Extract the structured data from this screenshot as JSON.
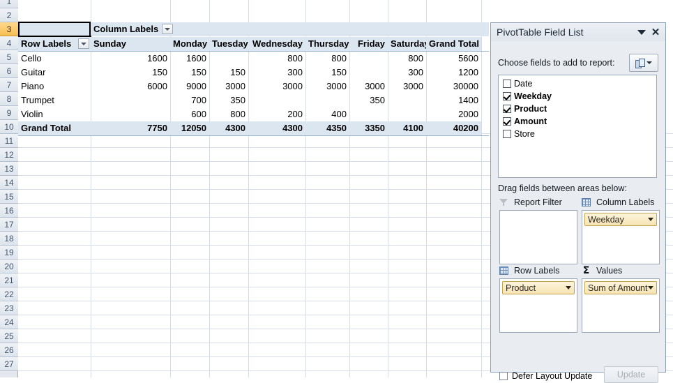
{
  "sheet": {
    "row_headers": [
      "1",
      "2",
      "3",
      "4",
      "5",
      "6",
      "7",
      "8",
      "9",
      "10",
      "11",
      "12",
      "13",
      "14",
      "15",
      "16",
      "17",
      "18",
      "19",
      "20",
      "21",
      "22",
      "23",
      "24",
      "25",
      "26",
      "27"
    ],
    "active_row": "3"
  },
  "pivot": {
    "value_header": "Sum of Amount",
    "column_labels_header": "Column Labels",
    "row_labels_header": "Row Labels",
    "columns": [
      "Sunday",
      "Monday",
      "Tuesday",
      "Wednesday",
      "Thursday",
      "Friday",
      "Saturday",
      "Grand Total"
    ],
    "rows": [
      {
        "label": "Cello",
        "values": [
          "1600",
          "1600",
          "",
          "800",
          "800",
          "",
          "800",
          "5600"
        ]
      },
      {
        "label": "Guitar",
        "values": [
          "150",
          "150",
          "150",
          "300",
          "150",
          "",
          "300",
          "1200"
        ]
      },
      {
        "label": "Piano",
        "values": [
          "6000",
          "9000",
          "3000",
          "3000",
          "3000",
          "3000",
          "3000",
          "30000"
        ]
      },
      {
        "label": "Trumpet",
        "values": [
          "",
          "700",
          "350",
          "",
          "",
          "350",
          "",
          "1400"
        ]
      },
      {
        "label": "Violin",
        "values": [
          "",
          "600",
          "800",
          "200",
          "400",
          "",
          "",
          "2000"
        ]
      }
    ],
    "grand_total": {
      "label": "Grand Total",
      "values": [
        "7750",
        "12050",
        "4300",
        "4300",
        "4350",
        "3350",
        "4100",
        "40200"
      ]
    }
  },
  "panel": {
    "title": "PivotTable Field List",
    "choose_label": "Choose fields to add to report:",
    "fields": [
      {
        "name": "Date",
        "checked": false
      },
      {
        "name": "Weekday",
        "checked": true
      },
      {
        "name": "Product",
        "checked": true
      },
      {
        "name": "Amount",
        "checked": true
      },
      {
        "name": "Store",
        "checked": false
      }
    ],
    "drag_label": "Drag fields between areas below:",
    "areas": {
      "report_filter": {
        "label": "Report Filter",
        "items": []
      },
      "column_labels": {
        "label": "Column Labels",
        "items": [
          "Weekday"
        ]
      },
      "row_labels": {
        "label": "Row Labels",
        "items": [
          "Product"
        ]
      },
      "values": {
        "label": "Values",
        "items": [
          "Sum of Amount"
        ]
      }
    },
    "defer_label": "Defer Layout Update",
    "update_label": "Update"
  },
  "colors": {
    "band": "#dce6f1",
    "active_row_header": "#f7bf53",
    "pill": "#f6e4b4",
    "panel_bg": "#e9edf2"
  }
}
